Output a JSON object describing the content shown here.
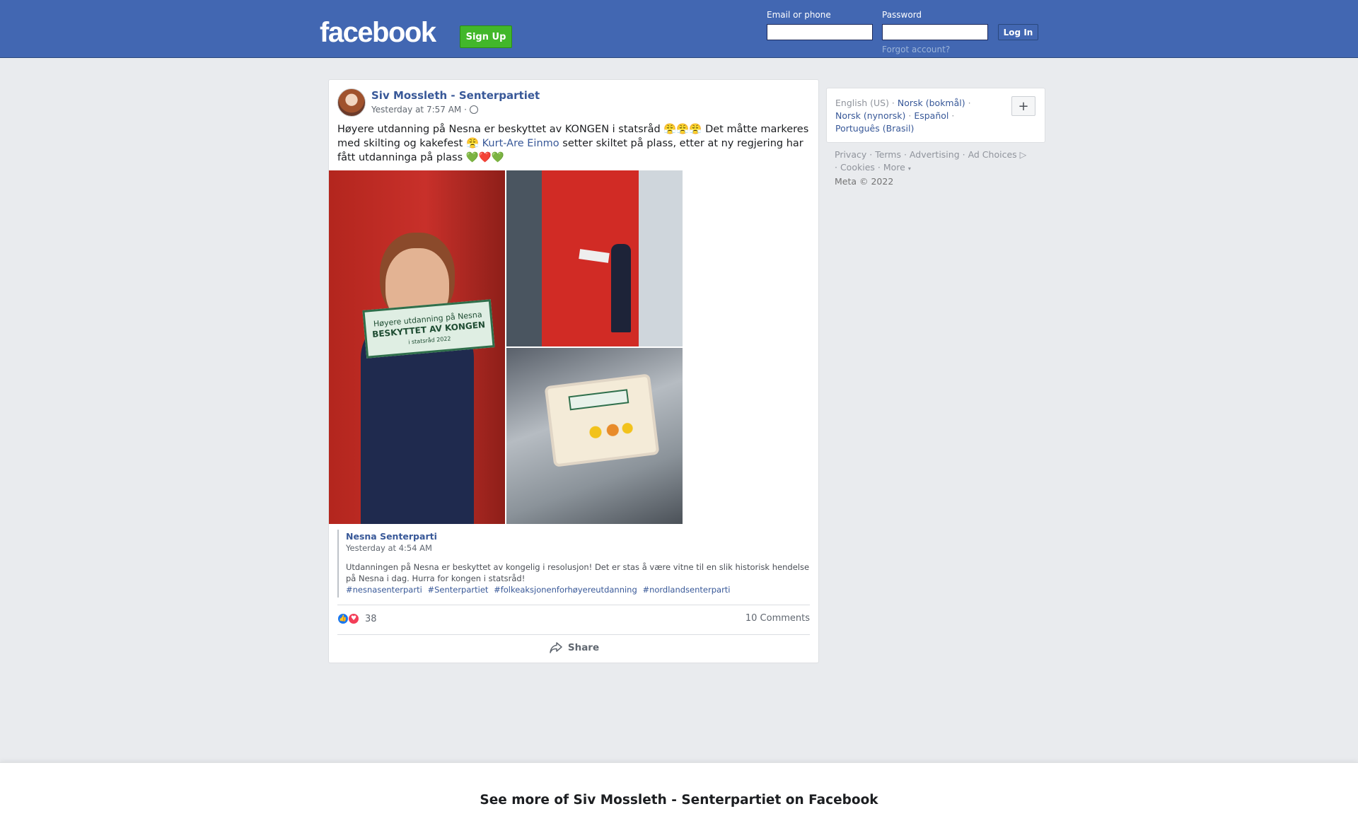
{
  "header": {
    "logo": "facebook",
    "signup_label": "Sign Up",
    "email_label": "Email or phone",
    "password_label": "Password",
    "login_label": "Log In",
    "forgot_label": "Forgot account?"
  },
  "post": {
    "author": "Siv Mossleth - Senterpartiet",
    "time": "Yesterday at 7:57 AM ·",
    "text_part1": "Høyere utdanning på Nesna er beskyttet av KONGEN i statsråd 😤😤😤 Det måtte markeres med skilting og kakefest 😤 ",
    "mention": "Kurt-Are Einmo",
    "text_part2": " setter skiltet på plass, etter at ny regjering har fått utdanninga på plass 💚❤️💚",
    "shared": {
      "author": "Nesna Senterparti",
      "time": "Yesterday at 4:54 AM",
      "text": "Utdanningen på Nesna er beskyttet av kongelig i resolusjon! Det er stas å være vitne til en slik historisk hendelse på Nesna i dag. Hurra for kongen i statsråd!",
      "hashtags": [
        "#nesnasenterparti",
        "#Senterpartiet",
        "#folkeaksjonenforhøyereutdanning",
        "#nordlandsenterparti"
      ]
    },
    "reactions_count": "38",
    "comments_label": "10 Comments",
    "share_label": "Share",
    "photo_sign_text": [
      "Høyere utdanning på Nesna",
      "BESKYTTET AV KONGEN",
      "i statsråd 2022"
    ]
  },
  "sidebar": {
    "languages": [
      "English (US)",
      "Norsk (bokmål)",
      "Norsk (nynorsk)",
      "Español",
      "Português (Brasil)"
    ],
    "add_language": "+",
    "footer_links": [
      "Privacy",
      "Terms",
      "Advertising",
      "Ad Choices",
      "Cookies",
      "More"
    ],
    "copyright": "Meta © 2022"
  },
  "banner": {
    "text": "See more of Siv Mossleth - Senterpartiet on Facebook"
  },
  "colors": {
    "brand_blue": "#4267b2",
    "signup_green": "#42b72a",
    "link_blue": "#385898"
  }
}
